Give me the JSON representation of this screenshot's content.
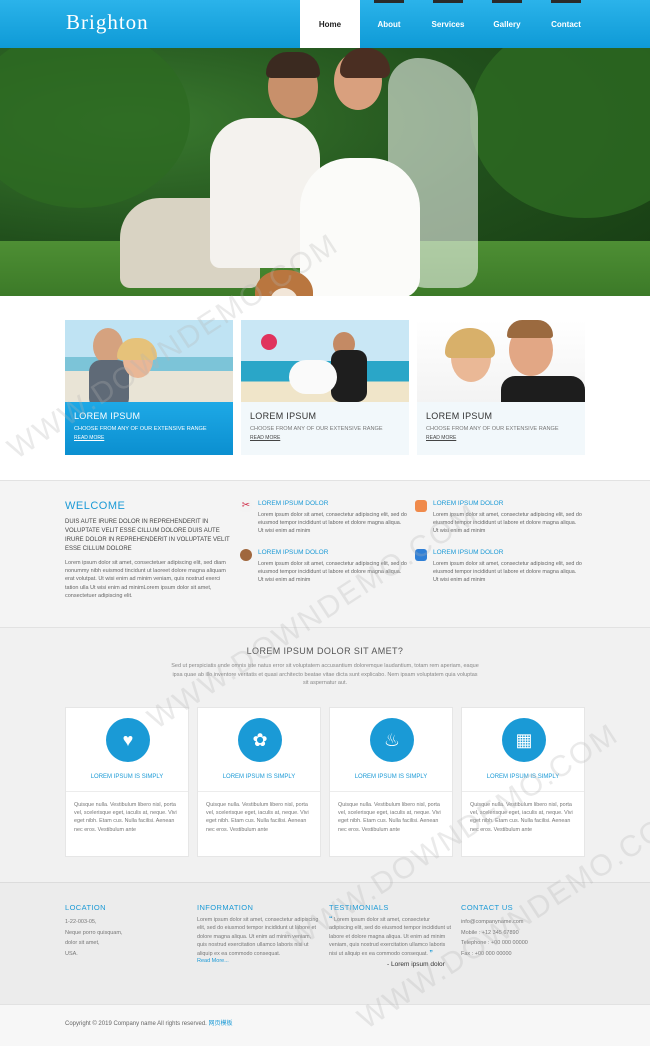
{
  "header": {
    "logo": "Brighton",
    "nav": [
      {
        "label": "Home",
        "active": true
      },
      {
        "label": "About",
        "active": false
      },
      {
        "label": "Services",
        "active": false
      },
      {
        "label": "Gallery",
        "active": false
      },
      {
        "label": "Contact",
        "active": false
      }
    ]
  },
  "features": [
    {
      "title": "LOREM IPSUM",
      "subtitle": "CHOOSE FROM ANY OF OUR EXTENSIVE RANGE",
      "link": "READ MORE"
    },
    {
      "title": "LOREM IPSUM",
      "subtitle": "CHOOSE FROM ANY OF OUR EXTENSIVE RANGE",
      "link": "READ MORE"
    },
    {
      "title": "LOREM IPSUM",
      "subtitle": "CHOOSE FROM ANY OF OUR EXTENSIVE RANGE",
      "link": "READ MORE"
    }
  ],
  "welcome": {
    "title": "WELCOME",
    "caps": "DUIS AUTE IRURE DOLOR IN REPREHENDERIT IN VOLUPTATE VELIT ESSE CILLUM DOLORE DUIS AUTE IRURE DOLOR IN REPREHENDERIT IN VOLUPTATE VELIT ESSE CILLUM DOLORE",
    "text": "Lorem ipsum dolor sit amet, consectetuer adipiscing elit, sed diam nonummy nibh euismod tincidunt ut laoreet dolore magna aliquam erat volutpat. Ut wisi enim ad minim veniam, quis nostrud exerci tation ulla Ut wisi enim ad minimLorem ipsum dolor sit amet, consectetuer adipiscing elit.",
    "items": [
      {
        "title": "LOREM IPSUM DOLOR",
        "text": "Lorem ipsum dolor sit amet, consectetur adipiscing elit, sed do eiusmod tempor incididunt ut labore et dolore magna aliqua. Ut wisi enim ad minim"
      },
      {
        "title": "LOREM IPSUM DOLOR",
        "text": "Lorem ipsum dolor sit amet, consectetur adipiscing elit, sed do eiusmod tempor incididunt ut labore et dolore magna aliqua. Ut wisi enim ad minim"
      },
      {
        "title": "LOREM IPSUM DOLOR",
        "text": "Lorem ipsum dolor sit amet, consectetur adipiscing elit, sed do eiusmod tempor incididunt ut labore et dolore magna aliqua. Ut wisi enim ad minim"
      },
      {
        "title": "LOREM IPSUM DOLOR",
        "text": "Lorem ipsum dolor sit amet, consectetur adipiscing elit, sed do eiusmod tempor incididunt ut labore et dolore magna aliqua. Ut wisi enim ad minim"
      }
    ]
  },
  "services": {
    "title": "LOREM IPSUM DOLOR SIT AMET?",
    "intro": "Sed ut perspiciatis unde omnis iste natus error sit voluptatem accusantium doloremque laudantium, totam rem aperiam, eaque ipsa quae ab illo inventore veritatis et quasi architecto beatae vitae dicta sunt explicabo. Nem ipsam voluptatem quia voluptas sit aspernatur aut.",
    "items": [
      {
        "icon": "heart-arrow-icon",
        "glyph": "♥",
        "title": "LOREM IPSUM IS SIMPLY",
        "text": "Quisque nulla. Vestibulum libero nisl, porta vel, scelerisque eget, iaculis at, neque. Vivi eget nibh. Etam cus. Nulla facilisi. Aenean nec eros. Vestibulum ante"
      },
      {
        "icon": "bouquet-icon",
        "glyph": "✿",
        "title": "LOREM IPSUM IS SIMPLY",
        "text": "Quisque nulla. Vestibulum libero nisl, porta vel, scelerisque eget, iaculis at, neque. Vivi eget nibh. Etam cus. Nulla facilisi. Aenean nec eros. Vestibulum ante"
      },
      {
        "icon": "cake-icon",
        "glyph": "♨",
        "title": "LOREM IPSUM IS SIMPLY",
        "text": "Quisque nulla. Vestibulum libero nisl, porta vel, scelerisque eget, iaculis at, neque. Vivi eget nibh. Etam cus. Nulla facilisi. Aenean nec eros. Vestibulum ante"
      },
      {
        "icon": "calendar-heart-icon",
        "glyph": "▦",
        "title": "LOREM IPSUM IS SIMPLY",
        "text": "Quisque nulla. Vestibulum libero nisl, porta vel, scelerisque eget, iaculis at, neque. Vivi eget nibh. Etam cus. Nulla facilisi. Aenean nec eros. Vestibulum ante"
      }
    ]
  },
  "footer": {
    "location": {
      "title": "LOCATION",
      "lines": [
        "1-22-003-05,",
        "Neque porro quisquam,",
        "dolor sit amet,",
        "USA."
      ]
    },
    "information": {
      "title": "INFORMATION",
      "text": "Lorem ipsum dolor sit amet, consectetur adipiscing elit, sed do eiusmod tempor incididunt ut labore et dolore magna aliqua. Ut enim ad minim veniam, quis nostrud exercitation ullamco laboris nisi ut aliquip ex ea commodo consequat.",
      "link": "Read More..."
    },
    "testimonials": {
      "title": "TESTIMONIALS",
      "text": "Lorem ipsum dolor sit amet, consectetur adipiscing elit, sed do eiusmod tempor incididunt ut labore et dolore magna aliqua. Ut enim ad minim veniam, quis nostrud exercitation ullamco laboris nisi ut aliquip ex ea commodo consequat.",
      "author": "- Lorem ipsum dolor"
    },
    "contact": {
      "title": "CONTACT US",
      "lines": [
        "info@companyname.com",
        "Mobile : +12 345 67890",
        "Telephone : +00 000 00000",
        "Fax : +00 000 00000"
      ]
    },
    "copyright": "Copyright © 2019 Company name All rights reserved.",
    "copyright_link": "网页模板"
  },
  "watermark": "WWW.DOWNDEMO.COM",
  "colors": {
    "accent": "#1b9ad6",
    "header": "#0e9ad6"
  }
}
